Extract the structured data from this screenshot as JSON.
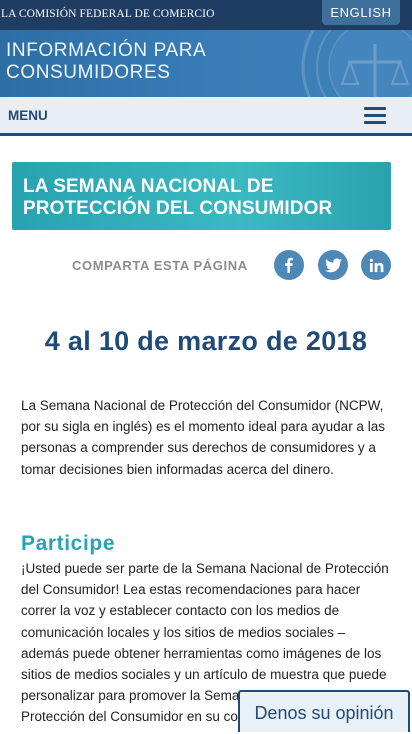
{
  "header": {
    "agency_name": "LA COMISIÓN FEDERAL DE COMERCIO",
    "language_button": "ENGLISH"
  },
  "banner": {
    "title_line1": "INFORMACIÓN PARA",
    "title_line2": "CONSUMIDORES"
  },
  "nav": {
    "menu_label": "MENU"
  },
  "campaign": {
    "title_line1": "LA SEMANA NACIONAL DE",
    "title_line2": "PROTECCIÓN DEL CONSUMIDOR"
  },
  "share": {
    "label": "COMPARTA ESTA PÁGINA",
    "icons": [
      "facebook-icon",
      "twitter-icon",
      "linkedin-icon"
    ]
  },
  "content": {
    "date_heading": "4 al 10 de marzo de 2018",
    "intro_paragraph": "La Semana Nacional de Protección del Consumidor (NCPW, por su sigla en inglés) es el momento ideal para ayudar a las personas a comprender sus derechos de consumidores y a tomar decisiones bien informadas acerca del dinero.",
    "section_heading": "Participe",
    "section_paragraph": "¡Usted puede ser parte de la Semana Nacional de Protección del Consumidor! Lea estas recomendaciones para hacer correr la voz y establecer contacto con los medios de comunicación locales y los sitios de medios sociales – además puede obtener herramientas como imágenes de los sitios de medios sociales y un artículo de muestra que puede personalizar para promover la Semana Nacional de Protección del Consumidor en su comunidad."
  },
  "feedback": {
    "label": "Denos su opinión"
  },
  "colors": {
    "navy": "#1f3c63",
    "banner_blue": "#3a7db6",
    "teal": "#2aa3b3",
    "social_blue": "#4d88b6"
  }
}
